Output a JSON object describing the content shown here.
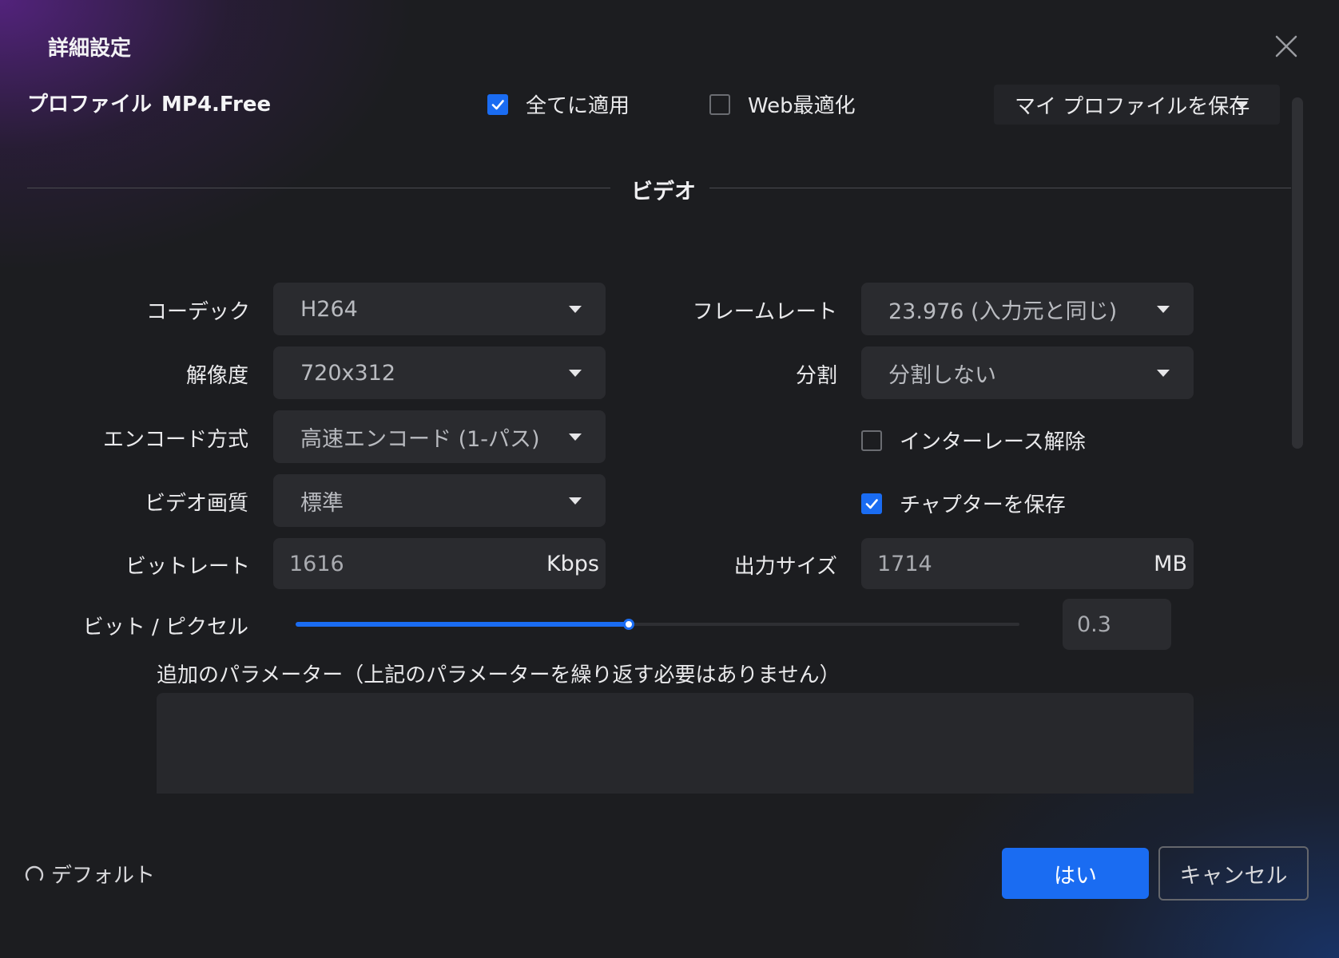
{
  "window": {
    "title": "詳細設定",
    "close_icon": "close-icon"
  },
  "profile": {
    "label": "プロファイル",
    "name": "MP4.Free"
  },
  "options": {
    "apply_all": {
      "label": "全てに適用",
      "checked": true
    },
    "web_optimize": {
      "label": "Web最適化",
      "checked": false
    }
  },
  "save_profile": {
    "label": "マイ プロファイルを保存"
  },
  "section": {
    "title": "ビデオ"
  },
  "video": {
    "codec": {
      "label": "コーデック",
      "value": "H264"
    },
    "resolution": {
      "label": "解像度",
      "value": "720x312"
    },
    "encode_method": {
      "label": "エンコード方式",
      "value": "高速エンコード (1-パス)"
    },
    "quality": {
      "label": "ビデオ画質",
      "value": "標準"
    },
    "bitrate": {
      "label": "ビットレート",
      "value": "1616",
      "unit": "Kbps"
    },
    "framerate": {
      "label": "フレームレート",
      "value": "23.976 (入力元と同じ)"
    },
    "split": {
      "label": "分割",
      "value": "分割しない"
    },
    "deinterlace": {
      "label": "インターレース解除",
      "checked": false
    },
    "save_chapters": {
      "label": "チャプターを保存",
      "checked": true
    },
    "output_size": {
      "label": "出力サイズ",
      "value": "1714",
      "unit": "MB"
    },
    "bits_per_pixel": {
      "label": "ビット / ピクセル",
      "value": "0.3",
      "slider_fraction": 0.46
    }
  },
  "extra_params": {
    "label": "追加のパラメーター（上記のパラメーターを繰り返す必要はありません）",
    "value": ""
  },
  "footer": {
    "default_label": "デフォルト",
    "ok_label": "はい",
    "cancel_label": "キャンセル"
  },
  "colors": {
    "accent": "#1a6cf2",
    "background": "#1c1d20",
    "field": "#2a2b2f"
  }
}
